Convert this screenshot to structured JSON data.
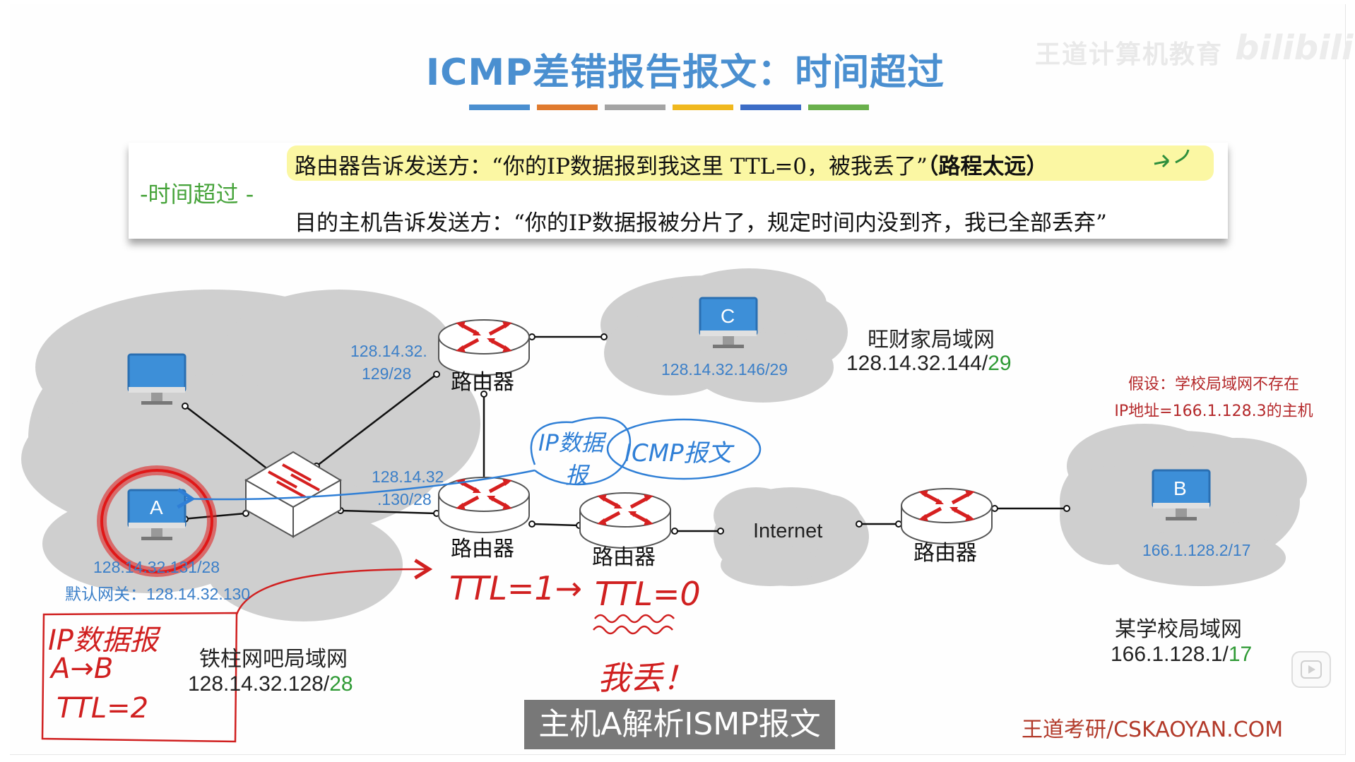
{
  "title": "ICMP差错报告报文：时间超过",
  "title_bar_colors": [
    "#4a8fd0",
    "#e07a2e",
    "#a4a4a4",
    "#f0b81e",
    "#3c6cc6",
    "#6ab04c"
  ],
  "watermark": "王道计算机教育",
  "watermark_logo": "bilibili",
  "definition": {
    "label": "时间超过",
    "line1_text": "路由器告诉发送方：“你的IP数据报到我这里 TTL=0，被我丢了”",
    "line1_bold": "（路程太远）",
    "line2": "目的主机告诉发送方：“你的IP数据报被分片了，规定时间内没到齐，我已全部丢弃”"
  },
  "networks": {
    "tiezhu": {
      "name": "铁柱网吧局域网",
      "ip": "128.14.32.128/",
      "mask": "28"
    },
    "wangcai": {
      "name": "旺财家局域网",
      "ip": "128.14.32.144/",
      "mask": "29"
    },
    "school": {
      "name": "某学校局域网",
      "ip": "166.1.128.1/",
      "mask": "17"
    }
  },
  "hosts": {
    "A": {
      "label": "A",
      "ip": "128.14.32.131/28",
      "gateway": "默认网关：128.14.32.130"
    },
    "B": {
      "label": "B",
      "ip": "166.1.128.2/17"
    },
    "C": {
      "label": "C",
      "ip": "128.14.32.146/29"
    }
  },
  "interfaces": {
    "r1_a": "128.14.32.",
    "r1_b": "129/28",
    "r2_a": "128.14.32",
    "r2_b": ".130/28"
  },
  "router_label": "路由器",
  "internet_label": "Internet",
  "assumption": {
    "line1": "假设：学校局域网不存在",
    "line2": "IP地址=166.1.128.3的主机"
  },
  "annotations": {
    "ip_datagram": "IP数据报",
    "arrow_ab": "A→B",
    "ttl2": "TTL=2",
    "ttl1": "TTL=1→",
    "ttl0": "TTL=0",
    "drop": "我丢！",
    "bubble_ip": "IP数据",
    "bubble_ip2": "报",
    "bubble_icmp": "ICMP报文"
  },
  "subtitle": "主机A解析ISMP报文",
  "brand": "王道考研/CSKAOYAN.COM",
  "colors": {
    "title": "#4a8fd0",
    "cloud": "#cfcfcf",
    "router_arrow": "#d62020",
    "handwriting_red": "#d02020",
    "handwriting_blue": "#2f7fd6",
    "monitor": "#3d8fd8"
  }
}
